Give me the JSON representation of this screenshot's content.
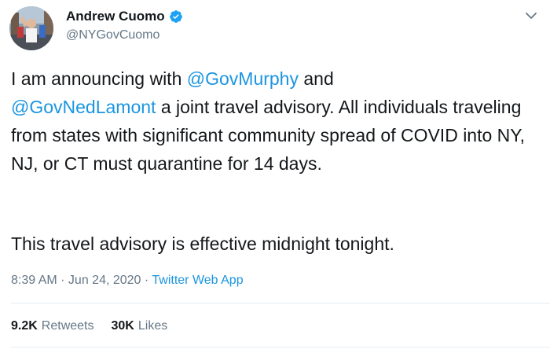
{
  "author": {
    "display_name": "Andrew Cuomo",
    "handle": "@NYGovCuomo",
    "verified_color": "#1da1f2"
  },
  "tweet": {
    "mention_1": "@GovMurphy",
    "mention_2": "@GovNedLamont",
    "text_1": "I am announcing with ",
    "text_2": " and",
    "text_3": " a joint travel advisory. All individuals traveling from states with significant community spread of COVID into NY, NJ, or CT must quarantine for 14 days.",
    "paragraph_2": "This travel advisory is effective midnight tonight."
  },
  "meta": {
    "time": "8:39 AM",
    "separator_1": " · ",
    "date": "Jun 24, 2020",
    "separator_2": " · ",
    "app": "Twitter Web App"
  },
  "stats": {
    "retweets_count": "9.2K",
    "retweets_label": "Retweets",
    "likes_count": "30K",
    "likes_label": "Likes"
  },
  "icons": {
    "more": "chevron-down-icon",
    "verified": "verified-badge-icon"
  },
  "colors": {
    "link": "#1b95e0",
    "secondary_text": "#657786",
    "primary_text": "#14171a"
  }
}
